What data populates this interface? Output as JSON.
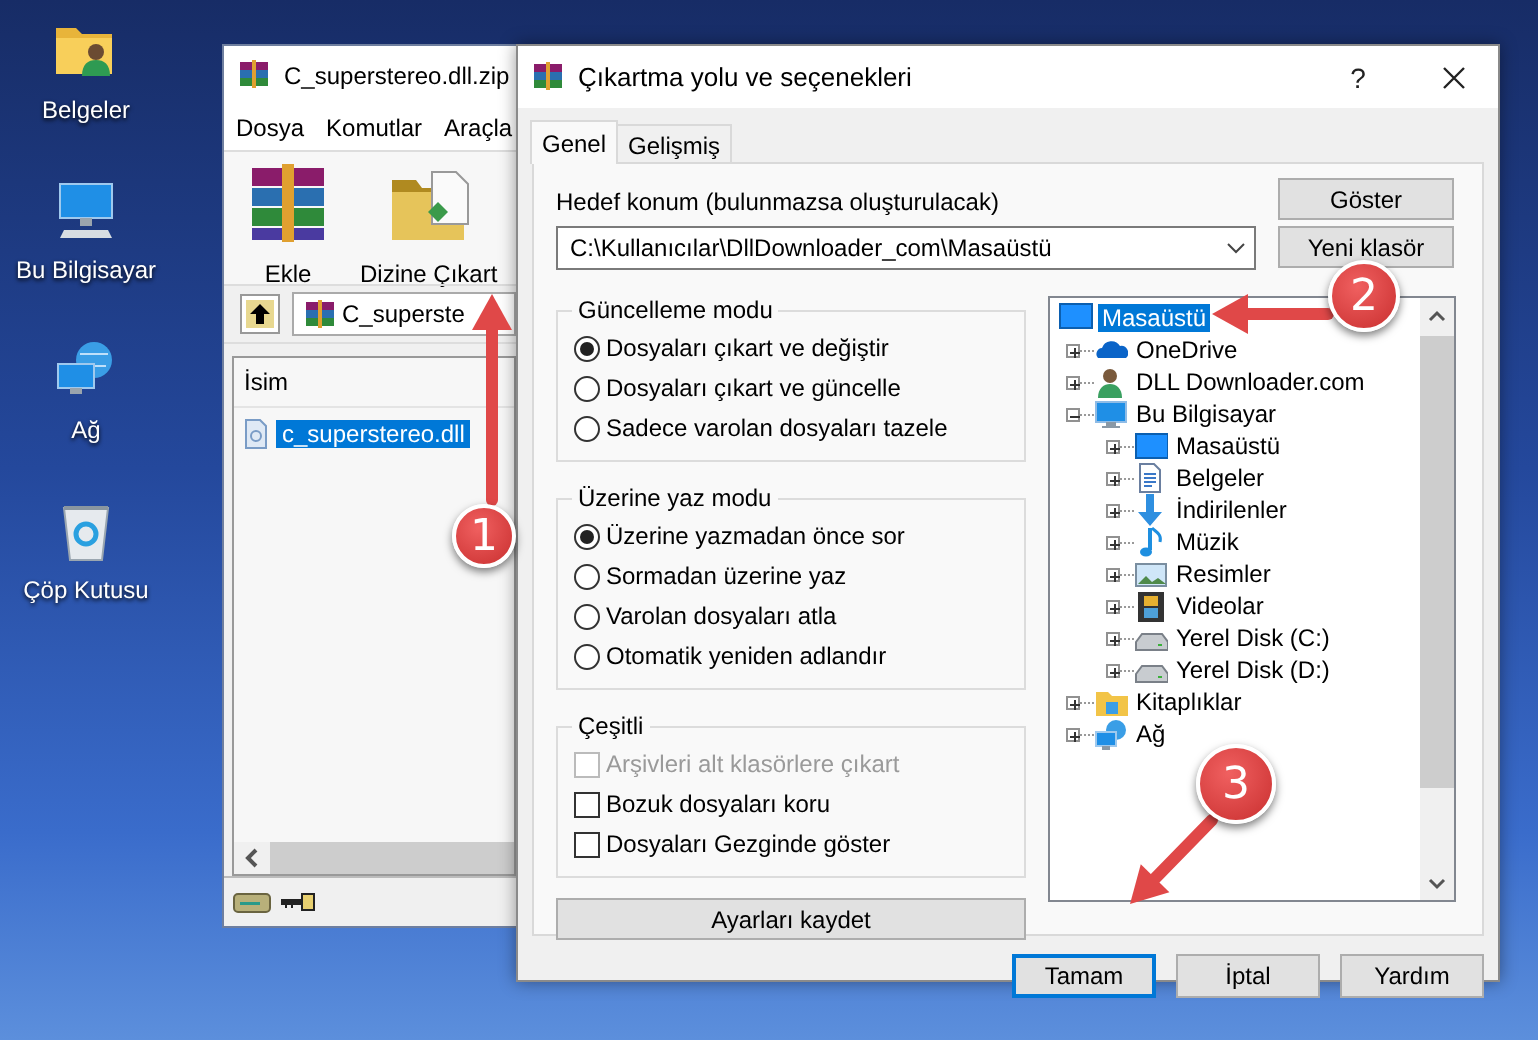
{
  "desktop_icons": [
    {
      "label": "Belgeler",
      "kind": "documents"
    },
    {
      "label": "Bu Bilgisayar",
      "kind": "computer"
    },
    {
      "label": "Ağ",
      "kind": "network"
    },
    {
      "label": "Çöp Kutusu",
      "kind": "recycle"
    }
  ],
  "archive_window": {
    "title": "C_superstereo.dll.zip",
    "menu": [
      "Dosya",
      "Komutlar",
      "Araçla"
    ],
    "toolbar": [
      {
        "label": "Ekle",
        "kind": "add"
      },
      {
        "label": "Dizine Çıkart",
        "kind": "extract"
      }
    ],
    "path": "C_superste",
    "columns": [
      "İsim"
    ],
    "files": [
      {
        "name": "c_superstereo.dll",
        "selected": true
      }
    ]
  },
  "dialog": {
    "title": "Çıkartma yolu ve seçenekleri",
    "help": "?",
    "tabs": [
      {
        "label": "Genel",
        "selected": true
      },
      {
        "label": "Gelişmiş",
        "selected": false
      }
    ],
    "destination": {
      "label": "Hedef konum (bulunmazsa oluşturulacak)",
      "value": "C:\\Kullanıcılar\\DllDownloader_com\\Masaüstü"
    },
    "side_buttons": [
      "Göster",
      "Yeni klasör"
    ],
    "groups": [
      {
        "title": "Güncelleme modu",
        "options": [
          {
            "kind": "radio",
            "label": "Dosyaları çıkart ve değiştir",
            "selected": true
          },
          {
            "kind": "radio",
            "label": "Dosyaları çıkart ve güncelle",
            "selected": false
          },
          {
            "kind": "radio",
            "label": "Sadece varolan dosyaları tazele",
            "selected": false
          }
        ]
      },
      {
        "title": "Üzerine yaz modu",
        "options": [
          {
            "kind": "radio",
            "label": "Üzerine yazmadan önce sor",
            "selected": true
          },
          {
            "kind": "radio",
            "label": "Sormadan üzerine yaz",
            "selected": false
          },
          {
            "kind": "radio",
            "label": "Varolan dosyaları atla",
            "selected": false
          },
          {
            "kind": "radio",
            "label": "Otomatik yeniden adlandır",
            "selected": false
          }
        ]
      },
      {
        "title": "Çeşitli",
        "options": [
          {
            "kind": "checkbox",
            "label": "Arşivleri alt klasörlere çıkart",
            "checked": false,
            "disabled": true
          },
          {
            "kind": "checkbox",
            "label": "Bozuk dosyaları koru",
            "checked": false,
            "disabled": false
          },
          {
            "kind": "checkbox",
            "label": "Dosyaları Gezginde göster",
            "checked": false,
            "disabled": false
          }
        ]
      }
    ],
    "save_button": "Ayarları kaydet",
    "tree": [
      {
        "label": "Masaüstü",
        "kind": "desktop",
        "selected": true,
        "children": [
          {
            "label": "OneDrive",
            "kind": "cloud",
            "selected": false,
            "expanded": false
          },
          {
            "label": "DLL Downloader.com",
            "kind": "user",
            "selected": false,
            "expanded": false
          },
          {
            "label": "Bu Bilgisayar",
            "kind": "computer",
            "selected": false,
            "expanded": true,
            "children": [
              {
                "label": "Masaüstü",
                "kind": "desktop",
                "selected": false,
                "expanded": false
              },
              {
                "label": "Belgeler",
                "kind": "documents",
                "selected": false,
                "expanded": false
              },
              {
                "label": "İndirilenler",
                "kind": "downloads",
                "selected": false,
                "expanded": false
              },
              {
                "label": "Müzik",
                "kind": "music",
                "selected": false,
                "expanded": false
              },
              {
                "label": "Resimler",
                "kind": "pictures",
                "selected": false,
                "expanded": false
              },
              {
                "label": "Videolar",
                "kind": "videos",
                "selected": false,
                "expanded": false
              },
              {
                "label": "Yerel Disk (C:)",
                "kind": "drive",
                "selected": false,
                "expanded": false
              },
              {
                "label": "Yerel Disk (D:)",
                "kind": "drive",
                "selected": false,
                "expanded": false
              }
            ]
          },
          {
            "label": "Kitaplıklar",
            "kind": "library",
            "selected": false,
            "expanded": false
          },
          {
            "label": "Ağ",
            "kind": "network",
            "selected": false,
            "expanded": false
          }
        ]
      }
    ],
    "buttons": [
      {
        "label": "Tamam",
        "default": true
      },
      {
        "label": "İptal",
        "default": false
      },
      {
        "label": "Yardım",
        "default": false
      }
    ]
  },
  "annotations": [
    {
      "number": "1"
    },
    {
      "number": "2"
    },
    {
      "number": "3"
    }
  ]
}
